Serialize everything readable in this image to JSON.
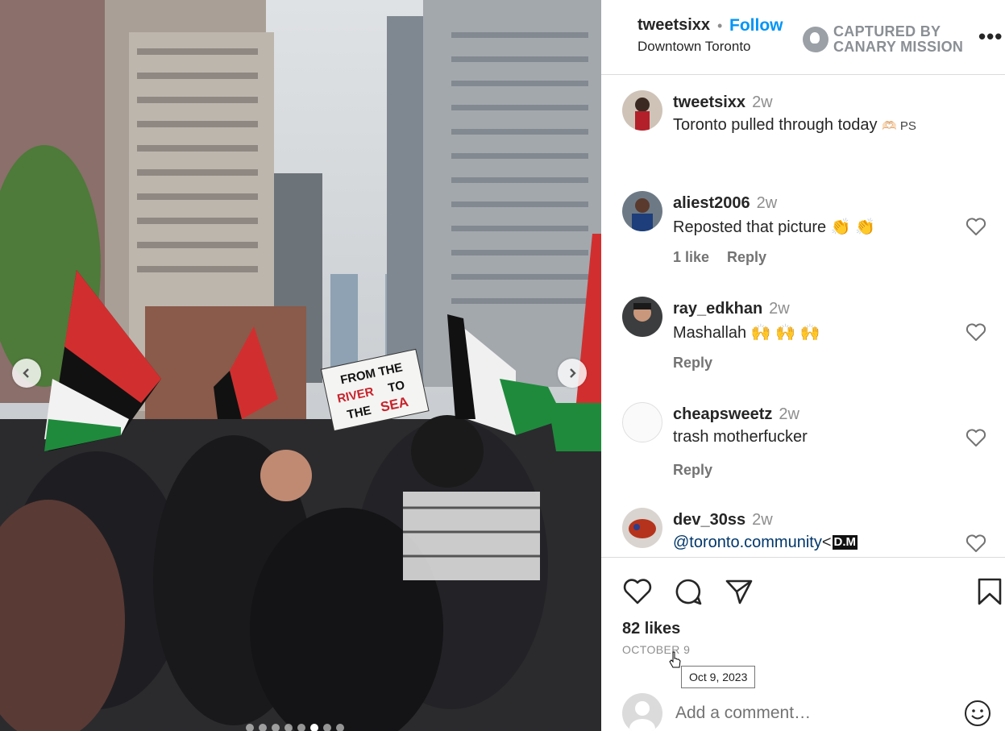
{
  "post": {
    "username": "tweetsixx",
    "separator": "•",
    "follow_label": "Follow",
    "location": "Downtown Toronto",
    "captured_by": "CAPTURED BY\nCANARY MISSION",
    "more_menu": "•••"
  },
  "photo": {
    "sign_line1": "FROM THE",
    "sign_line2_a": "RIVER",
    "sign_line2_b": "TO",
    "sign_line3_a": "THE",
    "sign_line3_b": "SEA",
    "carousel": {
      "total": 8,
      "active_index": 5
    },
    "prev_icon": "chevron-left-icon",
    "next_icon": "chevron-right-icon"
  },
  "comments": [
    {
      "username": "tweetsixx",
      "time": "2w",
      "text": "Toronto pulled through today",
      "text_extra": "🫶🏻 PS"
    },
    {
      "username": "aliest2006",
      "time": "2w",
      "text": "Reposted that picture 👏 👏",
      "likes": "1 like",
      "reply": "Reply"
    },
    {
      "username": "ray_edkhan",
      "time": "2w",
      "text": "Mashallah 🙌 🙌 🙌",
      "reply": "Reply"
    },
    {
      "username": "cheapsweetz",
      "time": "2w",
      "text": "trash motherfucker",
      "reply": "Reply"
    },
    {
      "username": "dev_30ss",
      "time": "2w",
      "mention": "@toronto.community",
      "text_after": "<",
      "dm_label": "D.M"
    }
  ],
  "actions": {
    "like_icon": "heart-icon",
    "comment_icon": "comment-bubble-icon",
    "share_icon": "paper-plane-icon",
    "save_icon": "bookmark-icon"
  },
  "likes_text": "82 likes",
  "date_text": "OCTOBER 9",
  "tooltip_text": "Oct 9, 2023",
  "add_comment_placeholder": "Add a comment…",
  "colors": {
    "accent": "#0095f6",
    "text": "#262626",
    "muted": "#8e8e8e",
    "border": "#dbdbdb"
  }
}
